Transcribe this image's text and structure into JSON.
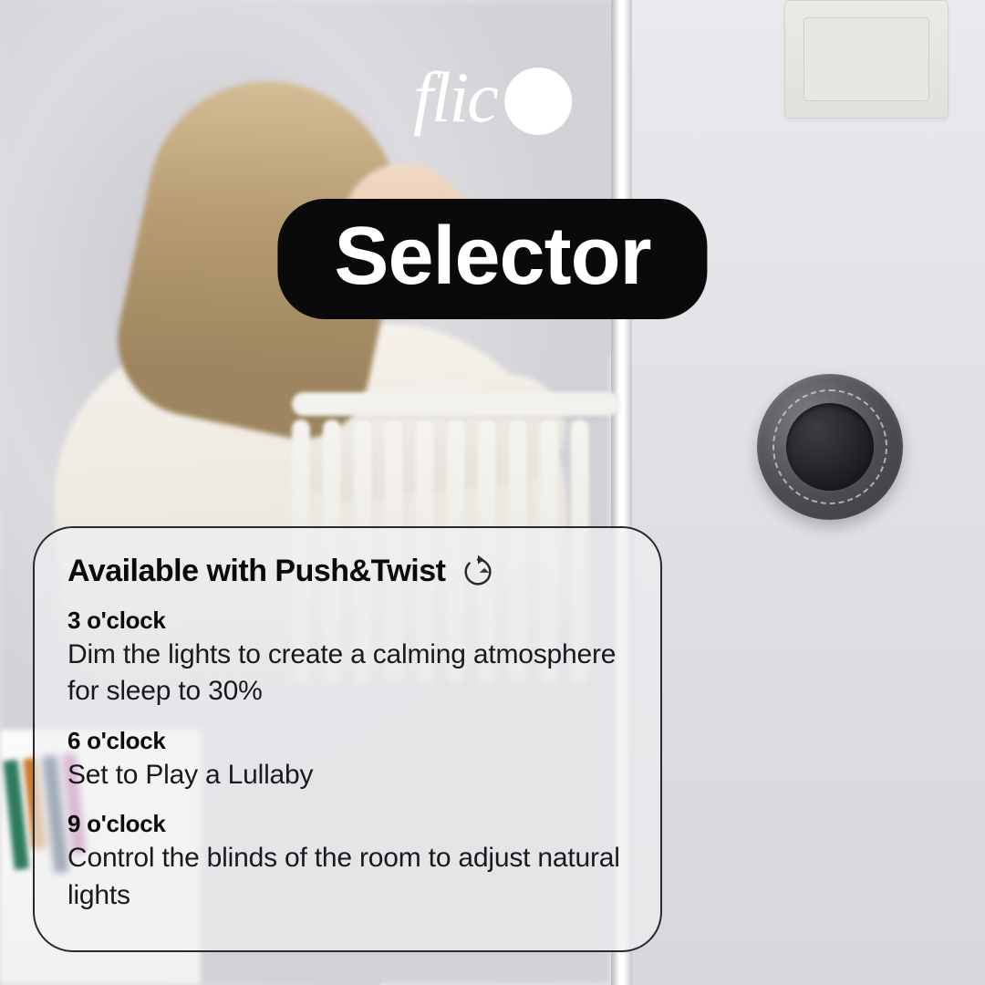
{
  "logo": {
    "text": "flic"
  },
  "title": "Selector",
  "card": {
    "header": "Available with Push&Twist",
    "features": [
      {
        "time": "3 o'clock",
        "desc": "Dim the lights to create a calming atmosphere for sleep to 30%"
      },
      {
        "time": "6 o'clock",
        "desc": "Set to Play a Lullaby"
      },
      {
        "time": "9 o'clock",
        "desc": "Control the blinds of the room to adjust natural lights"
      }
    ]
  }
}
